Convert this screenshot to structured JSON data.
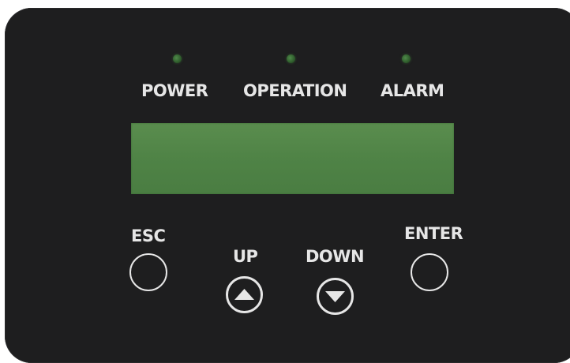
{
  "indicators": {
    "power_label": "POWER",
    "operation_label": "OPERATION",
    "alarm_label": "ALARM",
    "led_color": "#3f7a3a"
  },
  "display": {
    "color": "#4f8346"
  },
  "buttons": {
    "esc_label": "ESC",
    "up_label": "UP",
    "down_label": "DOWN",
    "enter_label": "ENTER"
  },
  "colors": {
    "panel": "#1e1e1f",
    "text": "#e6e6e6"
  }
}
